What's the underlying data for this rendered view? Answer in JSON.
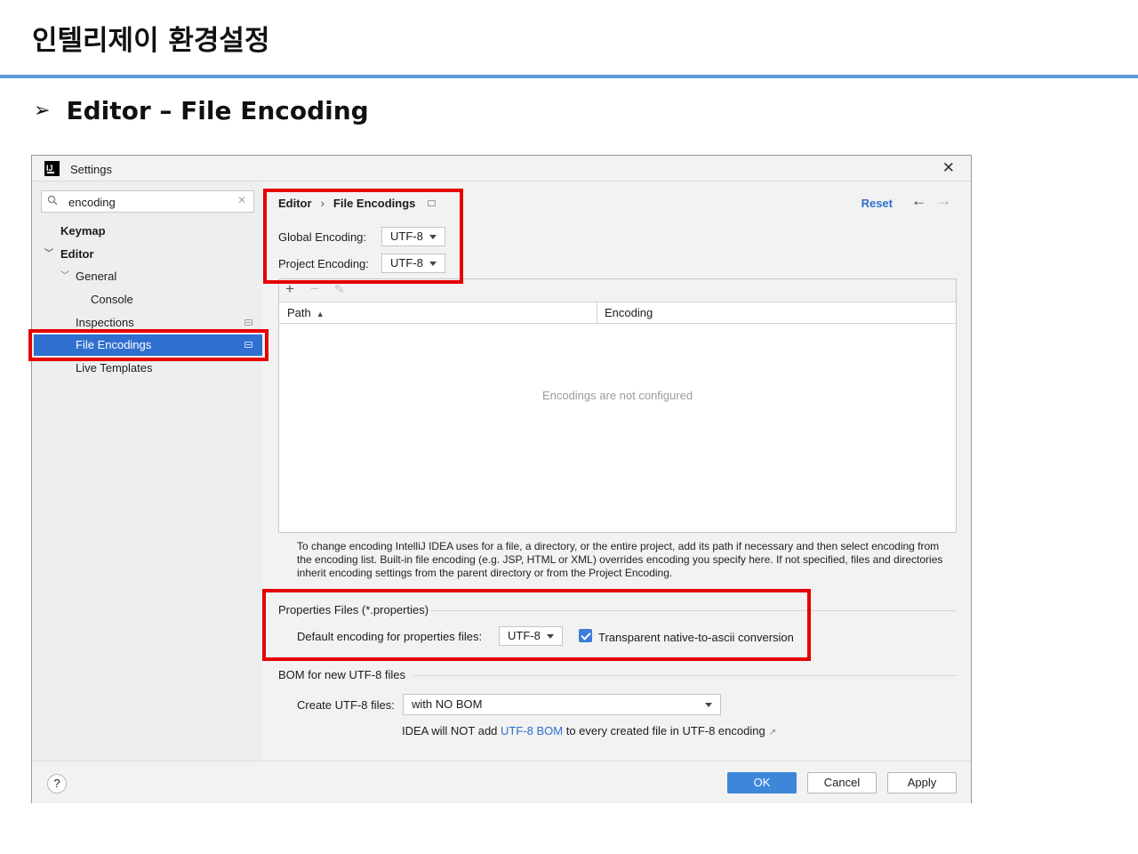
{
  "slide": {
    "title": "인텔리제이 환경설정",
    "section_heading": "Editor – File Encoding",
    "section_bullet": "➢"
  },
  "window": {
    "title": "Settings",
    "close_glyph": "✕"
  },
  "search": {
    "value": "encoding",
    "clear_glyph": "✕"
  },
  "sidebar": {
    "items": [
      {
        "label": "Keymap"
      },
      {
        "label": "Editor"
      },
      {
        "label": "General"
      },
      {
        "label": "Console"
      },
      {
        "label": "Inspections"
      },
      {
        "label": "File Encodings",
        "selected": true
      },
      {
        "label": "Live Templates"
      }
    ]
  },
  "breadcrumb": {
    "parent": "Editor",
    "separator": "›",
    "current": "File Encodings"
  },
  "header": {
    "reset_label": "Reset",
    "back_glyph": "←",
    "forward_glyph": "→"
  },
  "encoding_fields": {
    "global_label": "Global Encoding:",
    "global_value": "UTF-8",
    "project_label": "Project Encoding:",
    "project_value": "UTF-8"
  },
  "table": {
    "toolbar": {
      "add": "+",
      "remove": "−",
      "edit": "✎"
    },
    "columns": [
      "Path",
      "Encoding"
    ],
    "sort_glyph": "▲",
    "empty_text": "Encodings are not configured"
  },
  "help_text": "To change encoding IntelliJ IDEA uses for a file, a directory, or the entire project, add its path if necessary and then select encoding from the encoding list. Built-in file encoding (e.g. JSP, HTML or XML) overrides encoding you specify here. If not specified, files and directories inherit encoding settings from the parent directory or from the Project Encoding.",
  "properties_group": {
    "title": "Properties Files (*.properties)",
    "default_label": "Default encoding for properties files:",
    "default_value": "UTF-8",
    "checkbox_label": "Transparent native-to-ascii conversion",
    "checkbox_checked": true
  },
  "bom_group": {
    "title": "BOM for new UTF-8 files",
    "create_label": "Create UTF-8 files:",
    "create_value": "with NO BOM",
    "note_prefix": "IDEA will NOT add ",
    "note_link": "UTF-8 BOM",
    "note_suffix": " to every created file in UTF-8 encoding",
    "ext_glyph": "↗"
  },
  "footer": {
    "help_glyph": "?",
    "ok_label": "OK",
    "cancel_label": "Cancel",
    "apply_label": "Apply"
  },
  "colors": {
    "accent": "#2f6fcf",
    "highlight": "#e60000",
    "title_rule": "#5b9bd5"
  }
}
